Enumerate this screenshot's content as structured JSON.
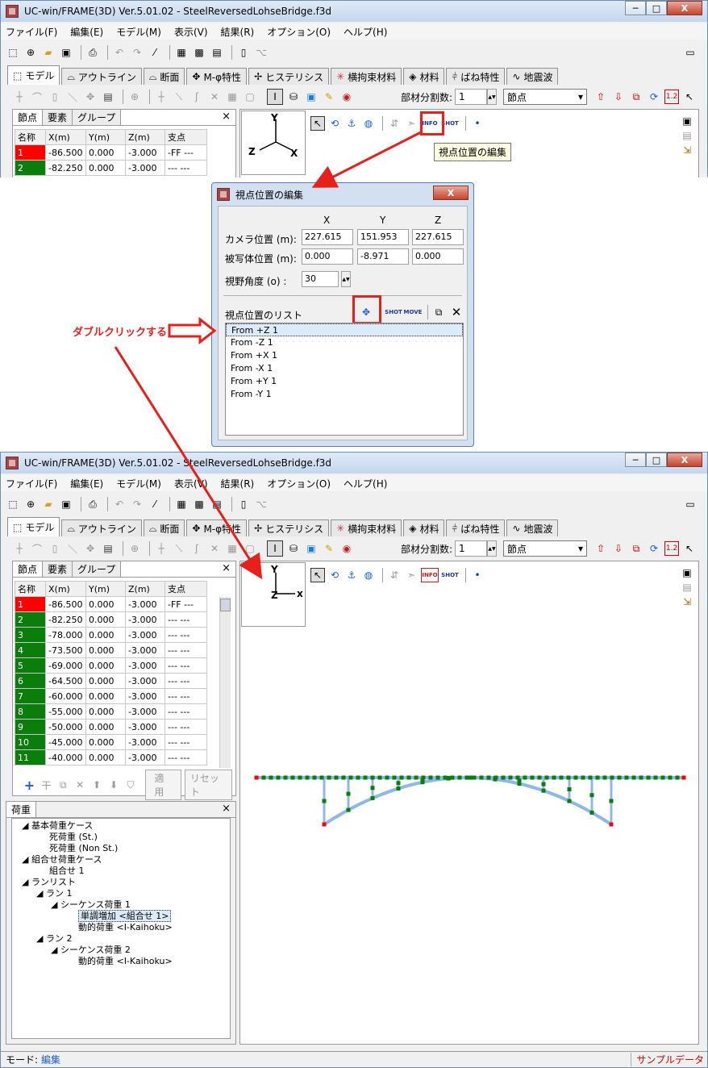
{
  "window": {
    "title": "UC-win/FRAME(3D) Ver.5.01.02 - SteelReversedLohseBridge.f3d",
    "min_label": "─",
    "max_label": "□",
    "close_label": "X"
  },
  "menu": [
    "ファイル(F)",
    "編集(E)",
    "モデル(M)",
    "表示(V)",
    "結果(R)",
    "オプション(O)",
    "ヘルプ(H)"
  ],
  "tabs": [
    {
      "icon": "⬚",
      "label": "モデル"
    },
    {
      "icon": "⌓",
      "label": "アウトライン"
    },
    {
      "icon": "⌓",
      "label": "断面"
    },
    {
      "icon": "✥",
      "label": "M-φ特性"
    },
    {
      "icon": "✢",
      "label": "ヒステリシス"
    },
    {
      "icon": "✳",
      "label": "横拘束材料"
    },
    {
      "icon": "◈",
      "label": "材料"
    },
    {
      "icon": "⫩",
      "label": "ばね特性"
    },
    {
      "icon": "∿",
      "label": "地震波"
    }
  ],
  "options": {
    "bunkatsu_label": "部材分割数:",
    "bunkatsu_value": "1",
    "select_value": "節点",
    "icon_12": "1.2"
  },
  "subtabs": [
    "節点",
    "要素",
    "グループ"
  ],
  "panel_close": "×",
  "table": {
    "headers": [
      "名称",
      "X(m)",
      "Y(m)",
      "Z(m)",
      "支点"
    ],
    "rows_top": [
      [
        "1",
        "-86.500",
        "0.000",
        "-3.000",
        "-FF ---"
      ],
      [
        "2",
        "-82.250",
        "0.000",
        "-3.000",
        "--- ---"
      ]
    ],
    "rows_bottom": [
      [
        "1",
        "-86.500",
        "0.000",
        "-3.000",
        "-FF ---"
      ],
      [
        "2",
        "-82.250",
        "0.000",
        "-3.000",
        "--- ---"
      ],
      [
        "3",
        "-78.000",
        "0.000",
        "-3.000",
        "--- ---"
      ],
      [
        "4",
        "-73.500",
        "0.000",
        "-3.000",
        "--- ---"
      ],
      [
        "5",
        "-69.000",
        "0.000",
        "-3.000",
        "--- ---"
      ],
      [
        "6",
        "-64.500",
        "0.000",
        "-3.000",
        "--- ---"
      ],
      [
        "7",
        "-60.000",
        "0.000",
        "-3.000",
        "--- ---"
      ],
      [
        "8",
        "-55.000",
        "0.000",
        "-3.000",
        "--- ---"
      ],
      [
        "9",
        "-50.000",
        "0.000",
        "-3.000",
        "--- ---"
      ],
      [
        "10",
        "-45.000",
        "0.000",
        "-3.000",
        "--- ---"
      ],
      [
        "11",
        "-40.000",
        "0.000",
        "-3.000",
        "--- ---"
      ]
    ]
  },
  "axes_top": {
    "y": "Y",
    "z": "Z",
    "x": "X"
  },
  "axes_bottom": {
    "y": "Y",
    "z": "Z",
    "x": "x"
  },
  "view_tool_labels": {
    "info": "INFO",
    "shot": "SHOT",
    "move": "MOVE"
  },
  "tooltip": "視点位置の編集",
  "dialog": {
    "title": "視点位置の編集",
    "close": "X",
    "col_x": "X",
    "col_y": "Y",
    "col_z": "Z",
    "camera_label": "カメラ位置 (m):",
    "camera": [
      "227.615",
      "151.953",
      "227.615"
    ],
    "target_label": "被写体位置 (m):",
    "target": [
      "0.000",
      "-8.971",
      "0.000"
    ],
    "fov_label": "視野角度 (o) :",
    "fov": "30",
    "list_label": "視点位置のリスト",
    "list_close": "✕",
    "list": [
      "From +Z 1",
      "From -Z 1",
      "From +X 1",
      "From -X 1",
      "From +Y 1",
      "From -Y 1"
    ]
  },
  "annotation": "ダブルクリックする",
  "edit_buttons": {
    "apply": "適用",
    "reset": "リセット"
  },
  "load_panel": {
    "tab": "荷重",
    "close": "×",
    "tree": [
      {
        "level": 0,
        "text": "基本荷重ケース"
      },
      {
        "level": 1,
        "text": "死荷重 (St.)"
      },
      {
        "level": 1,
        "text": "死荷重 (Non St.)"
      },
      {
        "level": 0,
        "text": "組合せ荷重ケース"
      },
      {
        "level": 1,
        "text": "組合せ 1"
      },
      {
        "level": 0,
        "text": "ランリスト"
      },
      {
        "level": 1,
        "text": "ラン 1"
      },
      {
        "level": 2,
        "text": "シーケンス荷重 1"
      },
      {
        "level": 3,
        "text": "単調増加 <組合せ 1>"
      },
      {
        "level": 3,
        "text": "動的荷重 <I-Kaihoku>"
      },
      {
        "level": 1,
        "text": "ラン 2"
      },
      {
        "level": 2,
        "text": "シーケンス荷重 2"
      },
      {
        "level": 3,
        "text": "動的荷重 <I-Kaihoku>"
      }
    ]
  },
  "status": {
    "mode_label": "モード:",
    "mode_value": "編集",
    "sample": "サンプルデータ"
  },
  "colors": {
    "accent_red": "#e8201c",
    "node_red": "#ff0000",
    "node_green": "#0a7d0a",
    "member_blue": "#8fb8e8"
  }
}
